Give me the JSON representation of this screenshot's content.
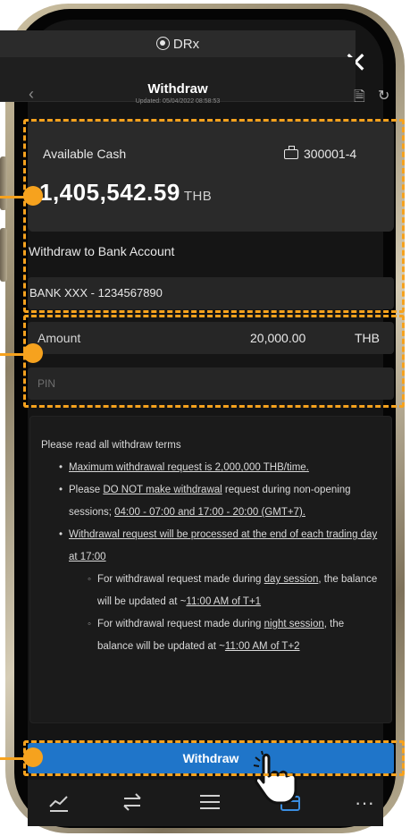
{
  "app": {
    "brand": "DRx"
  },
  "header": {
    "title": "Withdraw",
    "updated": "Updated: 05/04/2022 08:58:53"
  },
  "cash": {
    "label": "Available Cash",
    "account": "300001-4",
    "amount": "1,405,542.59",
    "currency": "THB"
  },
  "withdraw_to": {
    "label": "Withdraw to Bank Account",
    "bank": "BANK XXX - 1234567890"
  },
  "amount_field": {
    "label": "Amount",
    "value": "20,000.00",
    "currency": "THB"
  },
  "pin_field": {
    "placeholder": "PIN"
  },
  "terms": {
    "heading": "Please read all withdraw terms",
    "b1": "Maximum withdrawal request is 2,000,000 THB/time.",
    "b2_pre": "Please ",
    "b2_u1": "DO NOT make withdrawal",
    "b2_mid": " request during non-opening sessions; ",
    "b2_u2": "04:00 - 07:00 and 17:00 - 20:00 (GMT+7).",
    "b3": "Withdrawal request will be processed at the end of each trading day at 17:00",
    "s1_pre": "For withdrawal request made during ",
    "s1_u1": "day session",
    "s1_mid": ", the balance will be updated at ~",
    "s1_u2": "11:00 AM of T+1",
    "s2_pre": "For withdrawal request made during ",
    "s2_u1": "night session",
    "s2_mid": ", the balance will be updated at ~",
    "s2_u2": "11:00 AM of T+2"
  },
  "submit": {
    "label": "Withdraw"
  },
  "tabs": [
    "chart-icon",
    "swap-icon",
    "list-icon",
    "wallet-icon",
    "more-icon"
  ],
  "colors": {
    "accent": "#1f75c9",
    "highlight": "#f6a21e",
    "background": "#151515"
  }
}
